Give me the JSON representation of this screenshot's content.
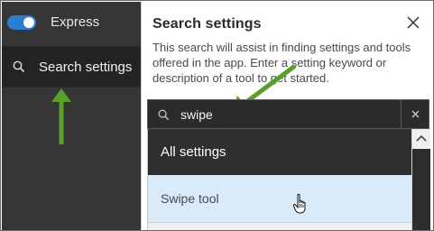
{
  "sidebar": {
    "toggle": {
      "label": "Express",
      "on": true,
      "color": "#2a7fd0"
    },
    "search_item": {
      "label": "Search settings",
      "icon": "search-icon"
    }
  },
  "panel": {
    "title": "Search settings",
    "description": "This search will assist in finding settings and tools offered in the app. Enter a setting keyword or description of a tool to get started.",
    "close_icon": "close-icon",
    "search": {
      "value": "swipe",
      "icon": "search-icon",
      "clear_icon": "close-icon"
    },
    "results": [
      {
        "label": "All settings"
      },
      {
        "label": "Swipe tool"
      }
    ]
  },
  "annotations": {
    "arrow_color": "#5a9e2c"
  }
}
